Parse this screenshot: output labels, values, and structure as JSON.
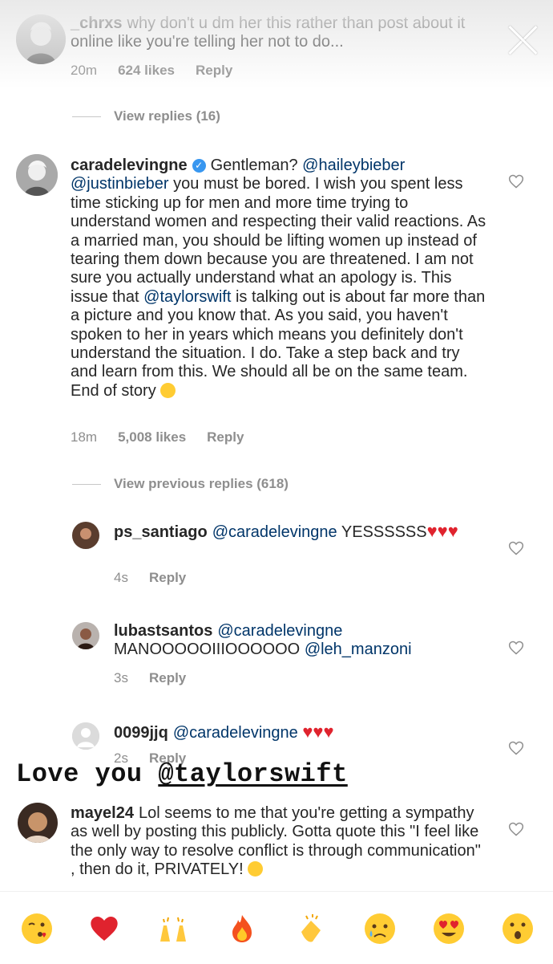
{
  "comments": [
    {
      "user": "_chrxs",
      "text": "why don't u dm her this rather than post about it online like you're telling her not to do...",
      "time": "20m",
      "likes": "624 likes",
      "reply": "Reply"
    },
    {
      "user": "caradelevingne",
      "text_parts": {
        "p1": "Gentleman?",
        "m1": "@haileybieber",
        "m2": "@justinbieber",
        "p2": "you must be bored. I wish you spent less time sticking up for men and more time trying to understand women and respecting their valid reactions. As a married man, you should be lifting women up instead of tearing them down because you are threatened. I am not sure you actually understand what an apology is. This issue that",
        "m3": "@taylorswift",
        "p3": "is talking out is about far more than a picture and you know that. As you said, you haven't spoken to her in years which means you definitely don't understand the situation. I do. Take a step back and try and learn from this. We should all be on the same team. End of story"
      },
      "time": "18m",
      "likes": "5,008 likes",
      "reply": "Reply"
    }
  ],
  "view_replies_1": "View replies (16)",
  "view_previous_replies": "View previous replies (618)",
  "replies": [
    {
      "user": "ps_santiago",
      "mention": "@caradelevingne",
      "text": "YESSSSSS",
      "time": "4s",
      "reply": "Reply"
    },
    {
      "user": "lubastsantos",
      "mention": "@caradelevingne",
      "text": "MANOOOOOIIIOOOOOO",
      "mention2": "@leh_manzoni",
      "time": "3s",
      "reply": "Reply"
    },
    {
      "user": "0099jjq",
      "mention": "@caradelevingne",
      "time": "2s",
      "reply": "Reply"
    }
  ],
  "last_comment": {
    "user": "mayel24",
    "text": "Lol seems to me that you're getting a sympathy as well by posting this publicly. Gotta quote this \"I feel like the only way to resolve conflict is through communication\" , then do it, PRIVATELY!"
  },
  "sticker": {
    "prefix": "Love you",
    "tag": "@taylorswift"
  },
  "emoji_bar": [
    "winking-kiss-face",
    "red-heart",
    "raising-hands",
    "fire",
    "clapping-hands",
    "crying-face",
    "heart-eyes-face",
    "surprised-face"
  ],
  "colors": {
    "mention": "#003569",
    "meta": "#8e8e8e",
    "heart_red": "#e0232e"
  }
}
